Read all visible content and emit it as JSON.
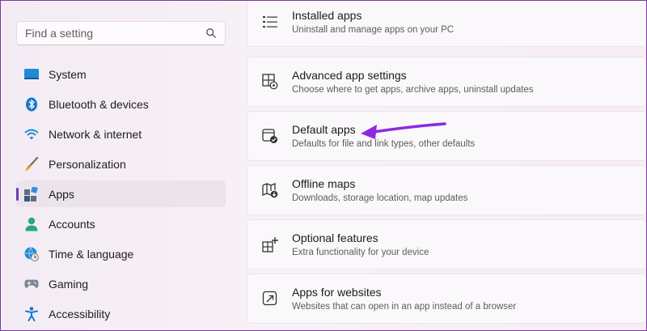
{
  "search": {
    "placeholder": "Find a setting"
  },
  "sidebar": {
    "items": [
      {
        "label": "System",
        "icon": "system-icon"
      },
      {
        "label": "Bluetooth & devices",
        "icon": "bluetooth-icon"
      },
      {
        "label": "Network & internet",
        "icon": "wifi-icon"
      },
      {
        "label": "Personalization",
        "icon": "brush-icon"
      },
      {
        "label": "Apps",
        "icon": "apps-icon",
        "active": true
      },
      {
        "label": "Accounts",
        "icon": "account-icon"
      },
      {
        "label": "Time & language",
        "icon": "globe-clock-icon"
      },
      {
        "label": "Gaming",
        "icon": "gamepad-icon"
      },
      {
        "label": "Accessibility",
        "icon": "accessibility-icon"
      }
    ]
  },
  "main": {
    "cards": [
      {
        "title": "Installed apps",
        "subtitle": "Uninstall and manage apps on your PC",
        "icon": "list-icon"
      },
      {
        "title": "Advanced app settings",
        "subtitle": "Choose where to get apps, archive apps, uninstall updates",
        "icon": "app-settings-icon"
      },
      {
        "title": "Default apps",
        "subtitle": "Defaults for file and link types, other defaults",
        "icon": "default-apps-icon"
      },
      {
        "title": "Offline maps",
        "subtitle": "Downloads, storage location, map updates",
        "icon": "map-download-icon"
      },
      {
        "title": "Optional features",
        "subtitle": "Extra functionality for your device",
        "icon": "optional-features-icon"
      },
      {
        "title": "Apps for websites",
        "subtitle": "Websites that can open in an app instead of a browser",
        "icon": "open-external-icon"
      }
    ]
  },
  "colors": {
    "accent": "#6a3fb5",
    "arrow": "#8a2be2",
    "frame": "#7a3aa0"
  }
}
